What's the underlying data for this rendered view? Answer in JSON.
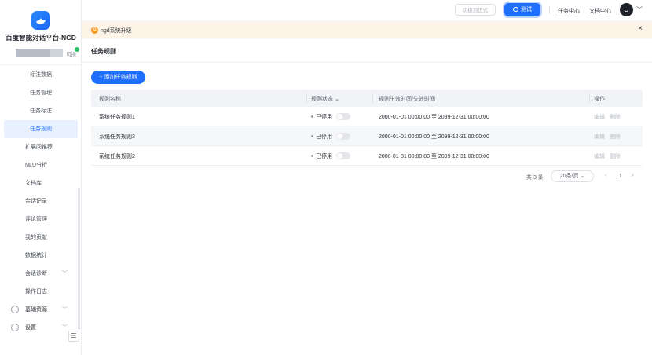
{
  "app": {
    "title": "百度智能对话平台-NGD",
    "switch_label": "切换"
  },
  "sidebar": {
    "items": [
      {
        "label": "标注数据",
        "sub": true
      },
      {
        "label": "任务管理",
        "sub": true
      },
      {
        "label": "任务标注",
        "sub": true
      },
      {
        "label": "任务规则",
        "sub": true,
        "active": true
      },
      {
        "label": "扩展问推荐"
      },
      {
        "label": "NLU分析"
      },
      {
        "label": "文档库"
      },
      {
        "label": "会话记录"
      },
      {
        "label": "评论管理"
      },
      {
        "label": "我的贡献"
      },
      {
        "label": "数据统计"
      },
      {
        "label": "会话诊断",
        "chevron": true
      },
      {
        "label": "操作日志"
      },
      {
        "label": "基础资源",
        "chevron": true,
        "icon": true
      },
      {
        "label": "设置",
        "chevron": true,
        "icon": true
      }
    ],
    "collapse_icon": "menu-fold-icon"
  },
  "header": {
    "switch_prod_label": "切换到正式",
    "test_label": "测试",
    "task_center": "任务中心",
    "doc_center": "文档中心",
    "avatar_letter": "U"
  },
  "notice": {
    "icon_letter": "G",
    "text": "ngd系统升级"
  },
  "page": {
    "title": "任务规则"
  },
  "toolbar": {
    "add_label": "添加任务规则"
  },
  "table": {
    "columns": [
      "规则名称",
      "规则状态",
      "规则生效时间/失效时间",
      "操作"
    ],
    "rows": [
      {
        "name": "系统任务规则1",
        "status": "已停用",
        "time": "2000-01-01 00:00:00 至 2099-12-31 00:00:00",
        "edit": "编辑",
        "delete": "删除"
      },
      {
        "name": "系统任务规则3",
        "status": "已停用",
        "time": "2000-01-01 00:00:00 至 2099-12-31 00:00:00",
        "edit": "编辑",
        "delete": "删除"
      },
      {
        "name": "系统任务规则2",
        "status": "已停用",
        "time": "2000-01-01 00:00:00 至 2099-12-31 00:00:00",
        "edit": "编辑",
        "delete": "删除"
      }
    ]
  },
  "pagination": {
    "total": "共 3 条",
    "page_size": "20条/页",
    "current_page": "1"
  },
  "colors": {
    "accent": "#1f6fff",
    "notice_bg": "#fdf3e6",
    "notice_icon": "#f59a23"
  }
}
